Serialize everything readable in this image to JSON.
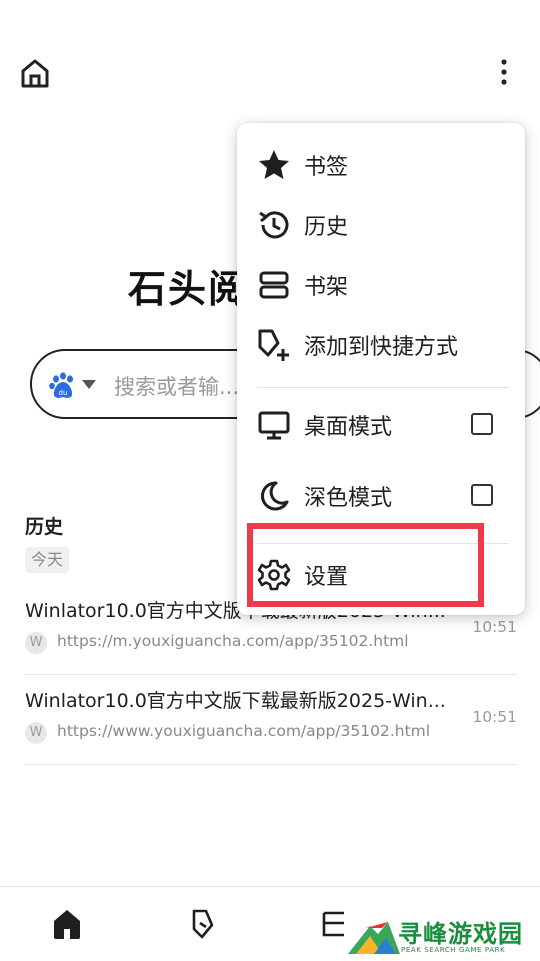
{
  "top_bar": {
    "home_icon": "home-icon",
    "more_icon": "more-vertical-icon"
  },
  "brand": {
    "title": "石头阅"
  },
  "search": {
    "engine_icon": "baidu-paw-icon",
    "placeholder": "搜索或者输..."
  },
  "history": {
    "heading": "历史",
    "group_label": "今天",
    "items": [
      {
        "title": "Winlator10.0官方中文版下载最新版2025-Win...",
        "favicon": "W",
        "url": "https://m.youxiguancha.com/app/35102.html",
        "time": "10:51"
      },
      {
        "title": "Winlator10.0官方中文版下载最新版2025-Win...",
        "favicon": "W",
        "url": "https://www.youxiguancha.com/app/35102.html",
        "time": "10:51"
      }
    ]
  },
  "menu": {
    "items": [
      {
        "label": "书签",
        "icon": "star-icon"
      },
      {
        "label": "历史",
        "icon": "history-icon"
      },
      {
        "label": "书架",
        "icon": "bookshelf-icon"
      },
      {
        "label": "添加到快捷方式",
        "icon": "add-shortcut-icon"
      },
      {
        "label": "桌面模式",
        "icon": "desktop-icon",
        "checked": false
      },
      {
        "label": "深色模式",
        "icon": "moon-icon",
        "checked": false
      },
      {
        "label": "设置",
        "icon": "gear-icon"
      }
    ],
    "highlight_color": "#f0394b"
  },
  "bottom_nav": {
    "items": [
      "home-icon",
      "shortcut-icon",
      "bookshelf-icon"
    ]
  },
  "watermark": {
    "title": "寻峰游戏园",
    "subtitle": "PEAK SEARCH GAME PARK"
  }
}
